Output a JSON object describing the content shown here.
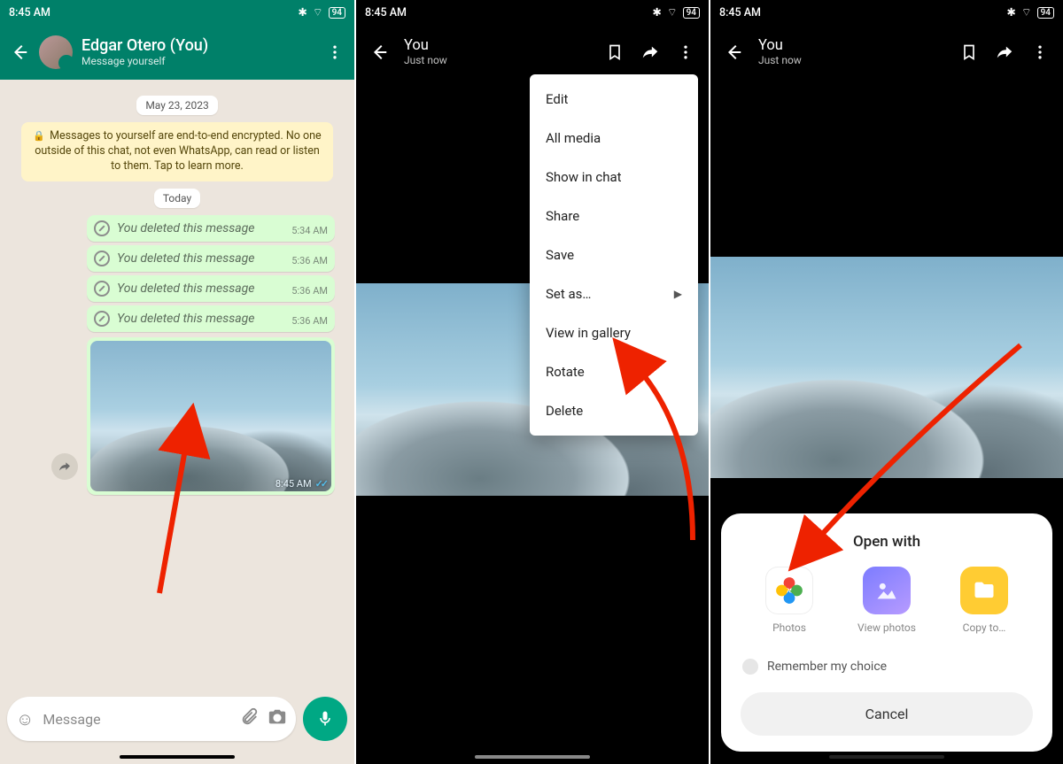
{
  "statusbar": {
    "time": "8:45 AM",
    "battery": "94"
  },
  "panel1": {
    "header": {
      "title": "Edgar Otero (You)",
      "subtitle": "Message yourself"
    },
    "date_chip": "May 23, 2023",
    "encryption_notice": "Messages to yourself are end-to-end encrypted. No one outside of this chat, not even WhatsApp, can read or listen to them. Tap to learn more.",
    "today_chip": "Today",
    "deleted": [
      {
        "text": "You deleted this message",
        "time": "5:34 AM"
      },
      {
        "text": "You deleted this message",
        "time": "5:36 AM"
      },
      {
        "text": "You deleted this message",
        "time": "5:36 AM"
      },
      {
        "text": "You deleted this message",
        "time": "5:36 AM"
      }
    ],
    "image_time": "8:45 AM",
    "input_placeholder": "Message"
  },
  "panel2": {
    "header": {
      "title": "You",
      "subtitle": "Just now"
    },
    "menu": [
      "Edit",
      "All media",
      "Show in chat",
      "Share",
      "Save",
      "Set as…",
      "View in gallery",
      "Rotate",
      "Delete"
    ]
  },
  "panel3": {
    "header": {
      "title": "You",
      "subtitle": "Just now"
    },
    "sheet": {
      "title": "Open with",
      "apps": [
        {
          "label": "Photos",
          "kind": "google-photos"
        },
        {
          "label": "View photos",
          "kind": "gallery"
        },
        {
          "label": "Copy to…",
          "kind": "files"
        }
      ],
      "remember": "Remember my choice",
      "cancel": "Cancel"
    }
  }
}
